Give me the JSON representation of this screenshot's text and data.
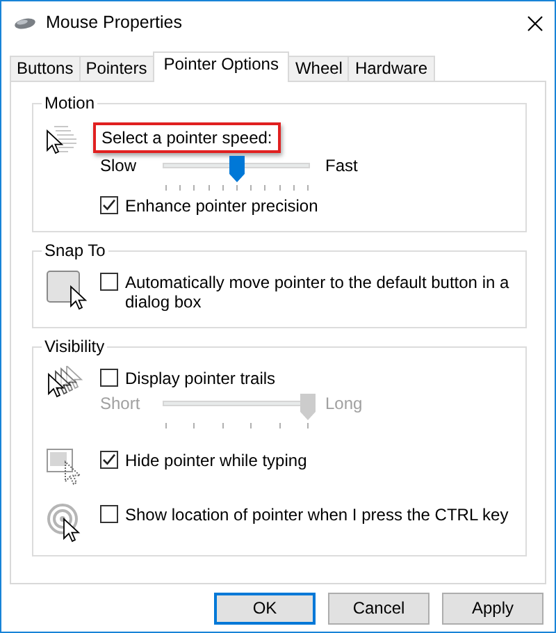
{
  "window": {
    "title": "Mouse Properties"
  },
  "tabs": [
    {
      "label": "Buttons",
      "selected": false
    },
    {
      "label": "Pointers",
      "selected": false
    },
    {
      "label": "Pointer Options",
      "selected": true
    },
    {
      "label": "Wheel",
      "selected": false
    },
    {
      "label": "Hardware",
      "selected": false
    }
  ],
  "groups": [
    {
      "title": "Motion",
      "blocks": [
        [
          {
            "kind": "label",
            "text": "Select a pointer speed:",
            "highlighted": true
          },
          {
            "kind": "slider",
            "min_label": "Slow",
            "max_label": "Fast",
            "level": 0.5,
            "disabled": false
          },
          {
            "kind": "checkbox",
            "label": "Enhance pointer precision",
            "checked": true
          }
        ]
      ]
    },
    {
      "title": "Snap To",
      "blocks": [
        [
          {
            "kind": "checkbox",
            "label": "Automatically move pointer to the default button in a dialog box",
            "checked": false
          }
        ]
      ]
    },
    {
      "title": "Visibility",
      "blocks": [
        [
          {
            "kind": "checkbox",
            "label": "Display pointer trails",
            "checked": false
          },
          {
            "kind": "slider",
            "min_label": "Short",
            "max_label": "Long",
            "level": 1,
            "disabled": true
          }
        ],
        [
          {
            "kind": "checkbox",
            "label": "Hide pointer while typing",
            "checked": true
          }
        ],
        [
          {
            "kind": "checkbox",
            "label": "Show location of pointer when I press the CTRL key",
            "checked": false
          }
        ]
      ]
    }
  ],
  "buttons": [
    {
      "label": "OK",
      "default": true
    },
    {
      "label": "Cancel",
      "default": false
    },
    {
      "label": "Apply",
      "default": false
    }
  ]
}
